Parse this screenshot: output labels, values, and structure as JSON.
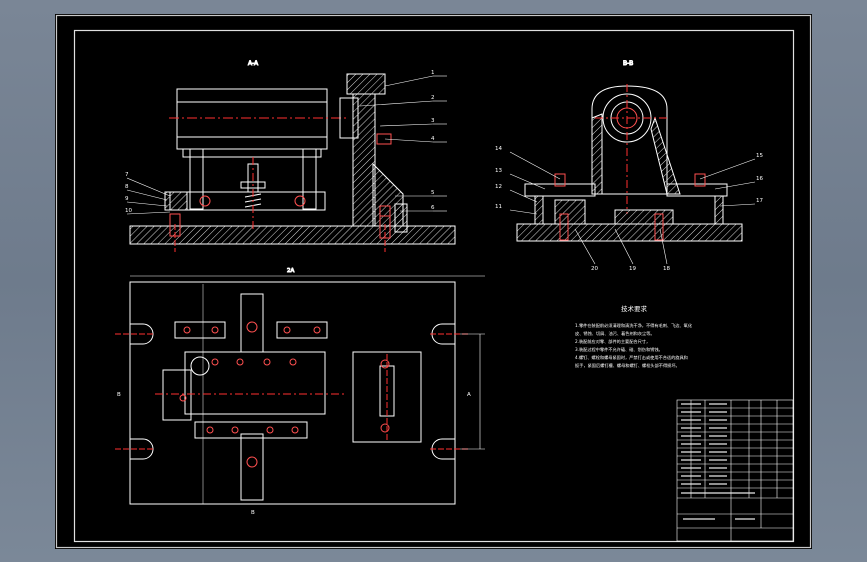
{
  "drawing": {
    "views": {
      "section_a_label": "A-A",
      "section_b_label": "B-B",
      "front_callouts": [
        "1",
        "2",
        "3",
        "4",
        "5",
        "6",
        "7",
        "8",
        "9",
        "10"
      ],
      "side_callouts_left": [
        "14",
        "13",
        "12",
        "11"
      ],
      "side_callouts_right": [
        "15",
        "16",
        "17"
      ],
      "side_bottom_labels": [
        "20",
        "19",
        "18"
      ],
      "plan_dim_top": "2A",
      "plan_mark_left": "B",
      "plan_mark_right": "A",
      "plan_mark_bottom": "B"
    },
    "notes": {
      "title": "技术要求",
      "lines": [
        "1.零件在装配前必须清理和清洗干净，不得有毛刺、飞边、氧化",
        "皮、锈蚀、切屑、油污、着色剂和灰尘等。",
        "2.装配前应对零、部件的主要配合尺寸，",
        "3.装配过程中零件不允许磕、碰、划伤和锈蚀。",
        "4.螺钉、螺栓和螺母紧固时，严禁打击或使用不合适的旋具和",
        "扳手，紧固后螺钉槽、螺母和螺钉、螺栓头部不得损坏。"
      ]
    }
  }
}
